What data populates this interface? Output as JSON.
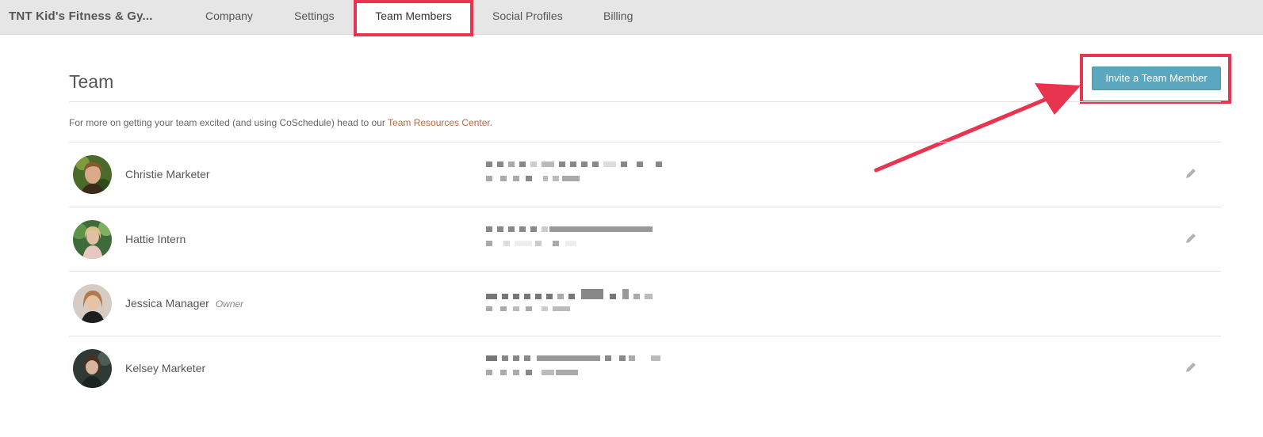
{
  "nav": {
    "brand": "TNT Kid's Fitness & Gy...",
    "tabs": [
      {
        "label": "Company"
      },
      {
        "label": "Settings"
      },
      {
        "label": "Team Members",
        "active": true
      },
      {
        "label": "Social Profiles"
      },
      {
        "label": "Billing"
      }
    ]
  },
  "header": {
    "title": "Team",
    "invite_label": "Invite a Team Member"
  },
  "resources": {
    "text": "For more on getting your team excited (and using CoSchedule) head to our ",
    "link": "Team Resources Center."
  },
  "members": [
    {
      "name": "Christie Marketer",
      "role": "",
      "editable": true
    },
    {
      "name": "Hattie Intern",
      "role": "",
      "editable": true
    },
    {
      "name": "Jessica Manager",
      "role": "Owner",
      "editable": false
    },
    {
      "name": "Kelsey Marketer",
      "role": "",
      "editable": true
    }
  ],
  "colors": {
    "accent_button": "#5aa7bf",
    "highlight": "#e8344e",
    "link": "#c7623a",
    "topbar": "#e6e6e6"
  }
}
